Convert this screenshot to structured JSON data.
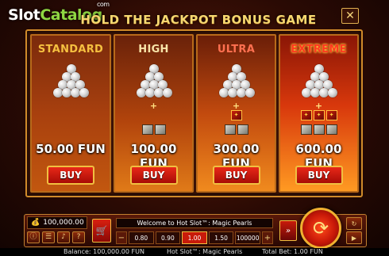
{
  "title": "HOLD THE JACKPOT BONUS GAME",
  "watermark": {
    "slot": "Slot",
    "catalog": "Catalog",
    "com": "com"
  },
  "close_label": "✕",
  "options": [
    {
      "tier": "STANDARD",
      "price": "50.00 FUN",
      "buy": "BUY",
      "extras": []
    },
    {
      "tier": "HIGH",
      "price": "100.00 FUN",
      "buy": "BUY",
      "extras": [
        "plain",
        "plain"
      ]
    },
    {
      "tier": "ULTRA",
      "price": "300.00 FUN",
      "buy": "BUY",
      "extras": [
        "mystery",
        "plain",
        "plain"
      ]
    },
    {
      "tier": "EXTREME",
      "price": "600.00 FUN",
      "buy": "BUY",
      "extras": [
        "mystery",
        "mystery",
        "mystery"
      ]
    }
  ],
  "controls": {
    "balance_value": "100,000.00",
    "welcome": "Welcome to Hot Slot™: Magic Pearls",
    "minus": "−",
    "plus": "+",
    "bets": [
      "0.80",
      "0.90",
      "1.00",
      "1.50",
      "100000"
    ],
    "selected_bet": "1.00"
  },
  "status": {
    "balance": "Balance: 100,000.00 FUN",
    "game": "Hot Slot™: Magic Pearls",
    "total_bet": "Total Bet: 1.00 FUN"
  },
  "icons": {
    "coin": "coin-icon",
    "cart": "cart-icon",
    "spin": "spin-arrows-icon",
    "info": "info-icon",
    "menu": "menu-icon",
    "sound": "sound-icon",
    "help": "help-icon",
    "turbo": "turbo-icon",
    "autoplay": "autoplay-icon",
    "play": "play-icon"
  },
  "colors": {
    "accent": "#f0c040",
    "buy_button": "#d82010",
    "extreme_label": "#ff3a20"
  }
}
